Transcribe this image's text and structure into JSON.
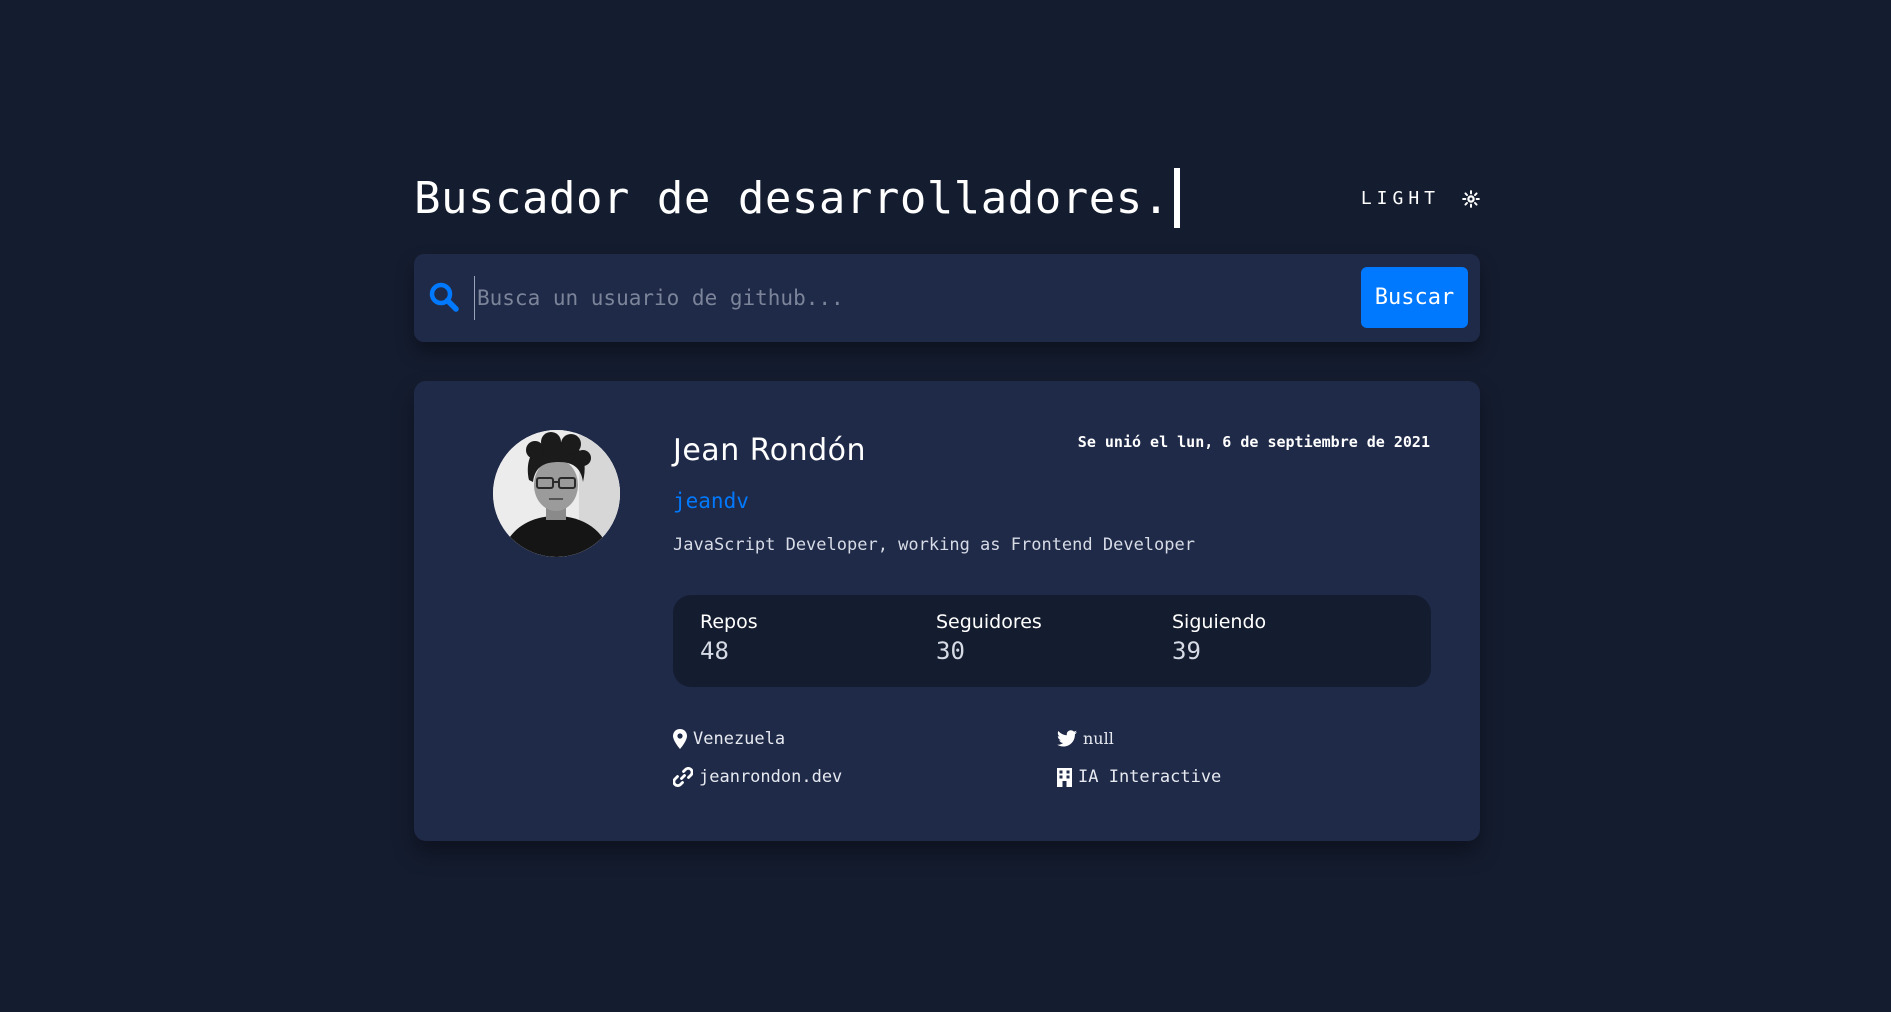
{
  "header": {
    "title": "Buscador de desarrolladores.",
    "theme_label": "LIGHT",
    "theme_icon": "sun-icon"
  },
  "search": {
    "placeholder": "Busca un usuario de github...",
    "value": "",
    "button_label": "Buscar",
    "icon": "search-icon"
  },
  "profile": {
    "name": "Jean Rondón",
    "login": "jeandv",
    "joined": "Se unió el lun, 6 de septiembre de 2021",
    "bio": "JavaScript Developer, working as Frontend Developer",
    "stats": [
      {
        "label": "Repos",
        "value": "48"
      },
      {
        "label": "Seguidores",
        "value": "30"
      },
      {
        "label": "Siguiendo",
        "value": "39"
      }
    ],
    "links": {
      "location": "Venezuela",
      "twitter": "null",
      "blog": "jeanrondon.dev",
      "company": "IA Interactive"
    }
  },
  "colors": {
    "background": "#141c2f",
    "card": "#1f2a48",
    "accent": "#0079ff",
    "text": "#ffffff"
  }
}
